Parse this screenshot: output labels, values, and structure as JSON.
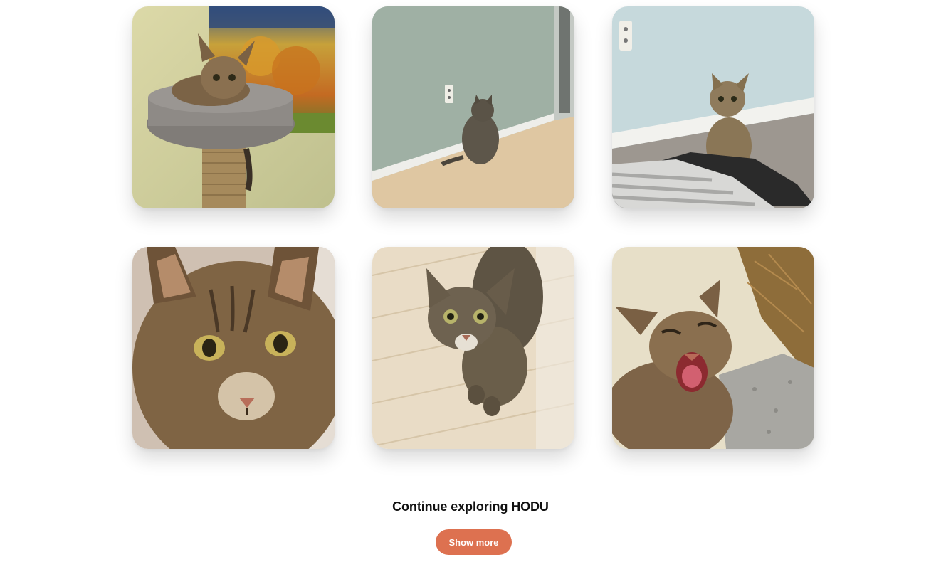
{
  "gallery": {
    "photos": [
      {
        "subject": "cat-on-scratching-post"
      },
      {
        "subject": "cat-facing-wall"
      },
      {
        "subject": "cat-sitting-on-floor"
      },
      {
        "subject": "cat-close-up-face"
      },
      {
        "subject": "cat-looking-up-on-floor"
      },
      {
        "subject": "cat-yawning"
      }
    ]
  },
  "footer": {
    "title": "Continue exploring HODU",
    "button_label": "Show more"
  },
  "colors": {
    "accent": "#dd7150",
    "title_text": "#111111",
    "background": "#ffffff"
  }
}
